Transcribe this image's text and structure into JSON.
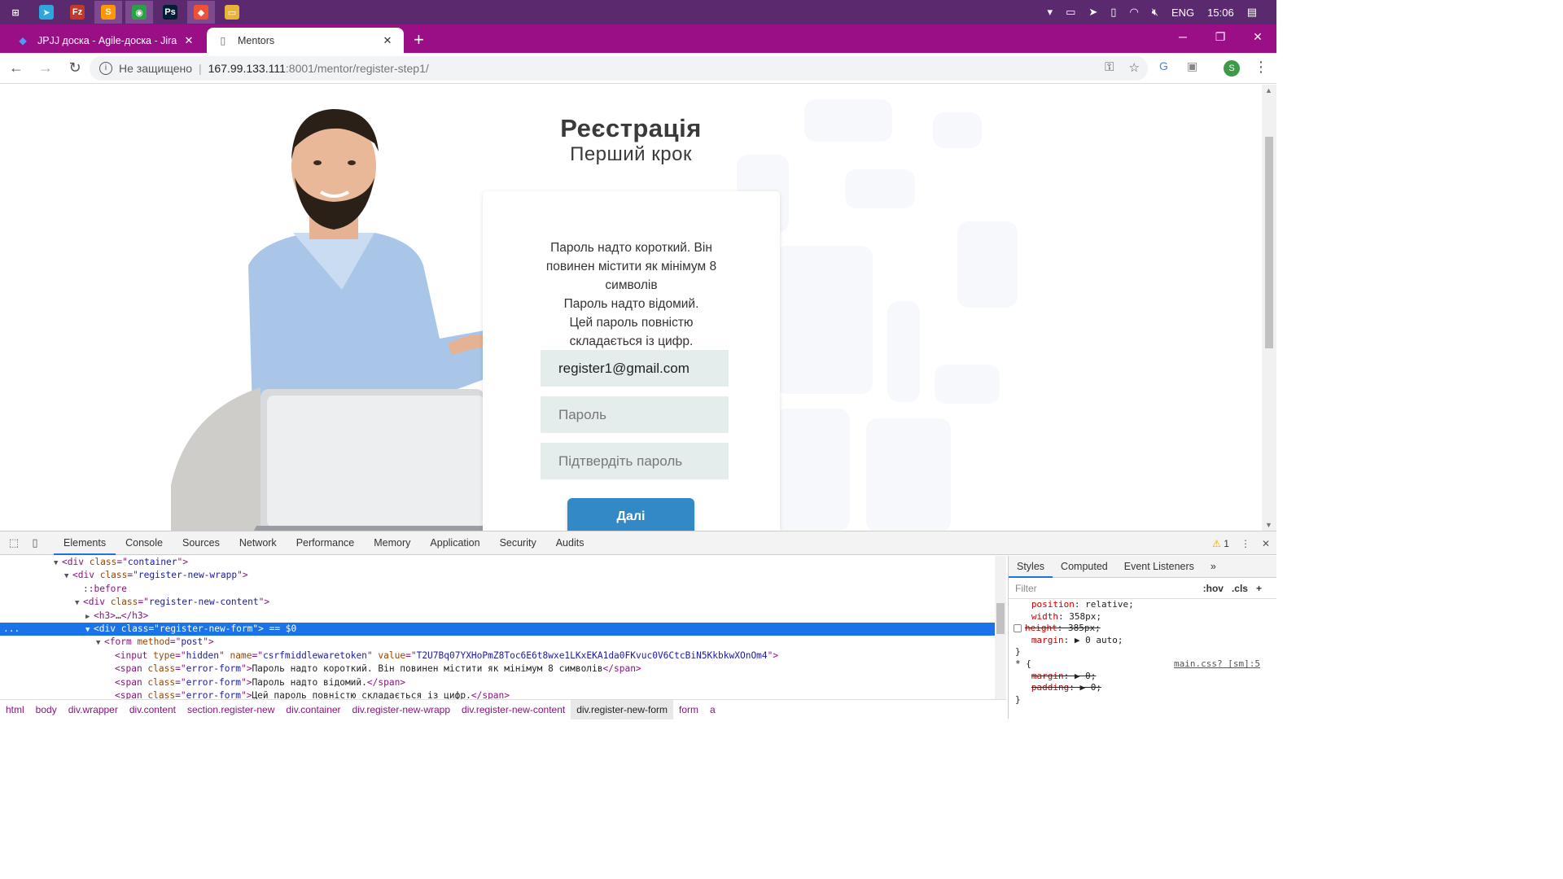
{
  "taskbar": {
    "apps": [
      {
        "name": "windows-start-icon",
        "glyph": "⊞",
        "color": "#5b2a6e"
      },
      {
        "name": "telegram-icon",
        "glyph": "➤",
        "color": "#2ea6dd"
      },
      {
        "name": "filezilla-icon",
        "glyph": "Fz",
        "color": "#c0392b"
      },
      {
        "name": "sublime-icon",
        "glyph": "S",
        "color": "#ff9800"
      },
      {
        "name": "chrome-icon",
        "glyph": "◉",
        "color": "#2d9f48"
      },
      {
        "name": "photoshop-icon",
        "glyph": "Ps",
        "color": "#001e36"
      },
      {
        "name": "git-icon",
        "glyph": "◆",
        "color": "#f05033"
      },
      {
        "name": "folder-icon",
        "glyph": "▭",
        "color": "#e8b339"
      }
    ],
    "tray": {
      "lang": "ENG",
      "time": "15:06"
    }
  },
  "browser": {
    "tabs": [
      {
        "title": "JPJJ доска - Agile-доска - Jira",
        "active": false
      },
      {
        "title": "Mentors",
        "active": true
      }
    ],
    "address": {
      "security": "Не защищено",
      "host": "167.99.133.111",
      "path": ":8001/mentor/register-step1/"
    },
    "profile_initial": "S"
  },
  "page": {
    "title": "Реєстрація",
    "subtitle": "Перший крок",
    "errors": [
      "Пароль надто короткий. Він повинен містити як мінімум 8 символів",
      "Пароль надто відомий.",
      "Цей пароль повністю складається із цифр."
    ],
    "fields": {
      "email_value": "register1@gmail.com",
      "password_placeholder": "Пароль",
      "confirm_placeholder": "Підтвердіть пароль"
    },
    "next_label": "Далі"
  },
  "devtools": {
    "tabs": [
      "Elements",
      "Console",
      "Sources",
      "Network",
      "Performance",
      "Memory",
      "Application",
      "Security",
      "Audits"
    ],
    "warning_count": "1",
    "dom_lines": [
      {
        "indent": 4,
        "tri": "▼",
        "html": "&lt;div <span class=\"attr\">class</span>=\"<span class=\"val\">container</span>\"&gt;"
      },
      {
        "indent": 5,
        "tri": "▼",
        "html": "&lt;div <span class=\"attr\">class</span>=\"<span class=\"val\">register-new-wrapp</span>\"&gt;"
      },
      {
        "indent": 6,
        "tri": "",
        "html": "<span class=\"pseudo\">::before</span>"
      },
      {
        "indent": 6,
        "tri": "▼",
        "html": "&lt;div <span class=\"attr\">class</span>=\"<span class=\"val\">register-new-content</span>\"&gt;"
      },
      {
        "indent": 7,
        "tri": "▶",
        "html": "&lt;h3&gt;<span class=\"txt\">…</span>&lt;/h3&gt;"
      },
      {
        "indent": 7,
        "tri": "▼",
        "html": "&lt;div <span class=\"attr\">class</span>=\"<span class=\"val\">register-new-form</span>\"&gt; <span class=\"txt\">== $0</span>",
        "selected": true
      },
      {
        "indent": 8,
        "tri": "▼",
        "html": "&lt;form <span class=\"attr\">method</span>=\"<span class=\"val\">post</span>\"&gt;"
      },
      {
        "indent": 9,
        "tri": "",
        "html": "&lt;input <span class=\"attr\">type</span>=\"<span class=\"val\">hidden</span>\" <span class=\"attr\">name</span>=\"<span class=\"val\">csrfmiddlewaretoken</span>\" <span class=\"attr\">value</span>=\"<span class=\"val\">T2U7Bq07YXHoPmZ8Toc6E6t8wxe1LKxEKA1da0FKvuc0V6CtcBiN5KkbkwXOnOm4</span>\"&gt;"
      },
      {
        "indent": 9,
        "tri": "",
        "html": "&lt;span <span class=\"attr\">class</span>=\"<span class=\"val\">error-form</span>\"&gt;<span class=\"txt\">Пароль надто короткий. Він повинен містити як мінімум 8 символів</span>&lt;/span&gt;"
      },
      {
        "indent": 9,
        "tri": "",
        "html": "&lt;span <span class=\"attr\">class</span>=\"<span class=\"val\">error-form</span>\"&gt;<span class=\"txt\">Пароль надто відомий.</span>&lt;/span&gt;"
      },
      {
        "indent": 9,
        "tri": "",
        "html": "&lt;span <span class=\"attr\">class</span>=\"<span class=\"val\">error-form</span>\"&gt;<span class=\"txt\">Цей пароль повністю складається із цифр.</span>&lt;/span&gt;"
      }
    ],
    "styles_tabs": [
      "Styles",
      "Computed",
      "Event Listeners",
      "»"
    ],
    "filter_placeholder": "Filter",
    "hov": ":hov",
    "cls": ".cls",
    "style_lines": [
      {
        "prop": "position",
        "value": "relative;"
      },
      {
        "prop": "width",
        "value": "358px;"
      },
      {
        "prop": "height",
        "value": "385px;",
        "strike": true
      },
      {
        "prop": "margin",
        "value": "▶ 0 auto;"
      }
    ],
    "rule2_selector": "* {",
    "rule2_link": "main.css? [sm]:5",
    "rule2_lines": [
      {
        "prop": "margin",
        "value": "▶ 0;",
        "strike": true
      },
      {
        "prop": "padding",
        "value": "▶ 0;",
        "strike": true
      }
    ],
    "breadcrumbs": [
      "html",
      "body",
      "div.wrapper",
      "div.content",
      "section.register-new",
      "div.container",
      "div.register-new-wrapp",
      "div.register-new-content",
      "div.register-new-form",
      "form",
      "a"
    ],
    "active_crumb": 8
  }
}
